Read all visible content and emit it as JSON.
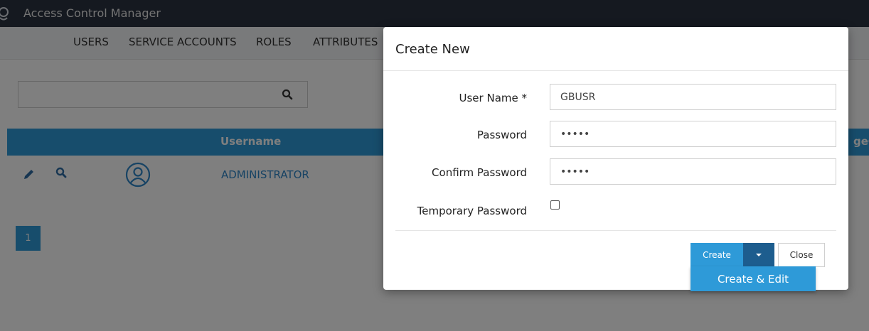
{
  "app": {
    "title": "Access Control Manager"
  },
  "nav": {
    "items": [
      "USERS",
      "SERVICE ACCOUNTS",
      "ROLES",
      "ATTRIBUTES"
    ]
  },
  "search": {
    "value": ""
  },
  "table": {
    "headers": {
      "username": "Username",
      "cut_off": "geCo"
    },
    "rows": [
      {
        "username": "ADMINISTRATOR"
      }
    ]
  },
  "pagination": {
    "current": "1"
  },
  "modal": {
    "title": "Create New",
    "fields": {
      "username": {
        "label": "User Name *",
        "value": "GBUSR"
      },
      "password": {
        "label": "Password",
        "value": "•••••"
      },
      "confirm_password": {
        "label": "Confirm Password",
        "value": "•••••"
      },
      "temporary_password": {
        "label": "Temporary Password",
        "checked": false
      }
    },
    "buttons": {
      "create": "Create",
      "close": "Close",
      "create_and_edit": "Create & Edit"
    }
  },
  "colors": {
    "topbar": "#2b3340",
    "accent": "#2e9ad8",
    "accent_dark": "#1d5d8e",
    "link": "#2e86c8"
  }
}
